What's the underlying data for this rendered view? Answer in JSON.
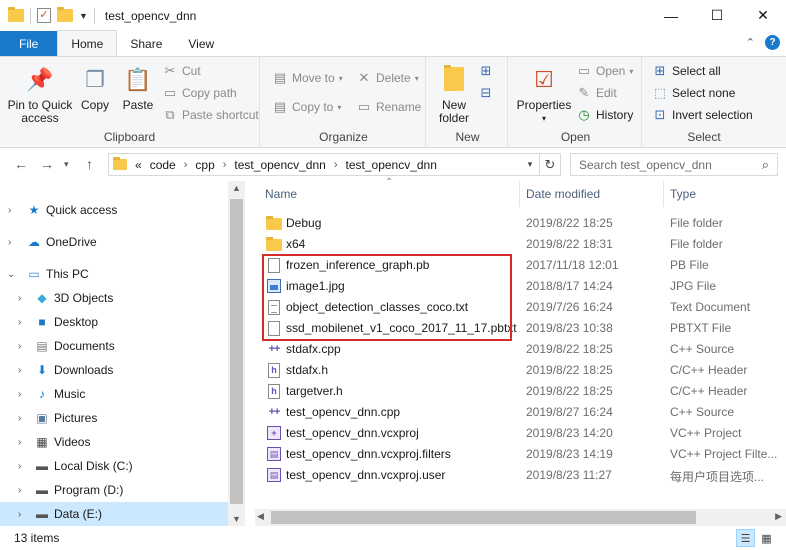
{
  "window": {
    "title": "test_opencv_dnn",
    "controls": {
      "minimize": "—",
      "maximize": "☐",
      "close": "✕"
    }
  },
  "ribbon_tabs": [
    {
      "label": "File"
    },
    {
      "label": "Home"
    },
    {
      "label": "Share"
    },
    {
      "label": "View"
    }
  ],
  "ribbon": {
    "clipboard": {
      "label": "Clipboard",
      "pin": "Pin to Quick access",
      "copy": "Copy",
      "paste": "Paste",
      "cut": "Cut",
      "copy_path": "Copy path",
      "paste_shortcut": "Paste shortcut"
    },
    "organize": {
      "label": "Organize",
      "move_to": "Move to",
      "copy_to": "Copy to",
      "delete": "Delete",
      "rename": "Rename"
    },
    "new": {
      "label": "New",
      "new_folder": "New folder"
    },
    "open": {
      "label": "Open",
      "properties": "Properties",
      "open": "Open",
      "edit": "Edit",
      "history": "History"
    },
    "select": {
      "label": "Select",
      "select_all": "Select all",
      "select_none": "Select none",
      "invert_selection": "Invert selection"
    }
  },
  "address": {
    "overflow": "«",
    "crumbs": [
      "code",
      "cpp",
      "test_opencv_dnn",
      "test_opencv_dnn"
    ],
    "search_placeholder": "Search test_opencv_dnn"
  },
  "nav_pane": {
    "items": [
      {
        "label": "Quick access",
        "icon": "star-icon"
      },
      {
        "label": "OneDrive",
        "icon": "cloud-icon"
      },
      {
        "label": "This PC",
        "icon": "computer-icon"
      },
      {
        "label": "3D Objects",
        "icon": "cube-icon"
      },
      {
        "label": "Desktop",
        "icon": "desktop-icon"
      },
      {
        "label": "Documents",
        "icon": "documents-icon"
      },
      {
        "label": "Downloads",
        "icon": "download-icon"
      },
      {
        "label": "Music",
        "icon": "music-icon"
      },
      {
        "label": "Pictures",
        "icon": "pictures-icon"
      },
      {
        "label": "Videos",
        "icon": "videos-icon"
      },
      {
        "label": "Local Disk (C:)",
        "icon": "drive-icon"
      },
      {
        "label": "Program (D:)",
        "icon": "drive-icon"
      },
      {
        "label": "Data (E:)",
        "icon": "drive-icon",
        "selected": true
      }
    ]
  },
  "file_list": {
    "columns": {
      "name": "Name",
      "date": "Date modified",
      "type": "Type"
    },
    "files": [
      {
        "name": "Debug",
        "date": "2019/8/22 18:25",
        "type": "File folder",
        "icon": "folder"
      },
      {
        "name": "x64",
        "date": "2019/8/22 18:31",
        "type": "File folder",
        "icon": "folder"
      },
      {
        "name": "frozen_inference_graph.pb",
        "date": "2017/11/18 12:01",
        "type": "PB File",
        "icon": "file"
      },
      {
        "name": "image1.jpg",
        "date": "2018/8/17 14:24",
        "type": "JPG File",
        "icon": "image"
      },
      {
        "name": "object_detection_classes_coco.txt",
        "date": "2019/7/26 16:24",
        "type": "Text Document",
        "icon": "text"
      },
      {
        "name": "ssd_mobilenet_v1_coco_2017_11_17.pbtxt",
        "date": "2019/8/23 10:38",
        "type": "PBTXT File",
        "icon": "file"
      },
      {
        "name": "stdafx.cpp",
        "date": "2019/8/22 18:25",
        "type": "C++ Source",
        "icon": "cpp"
      },
      {
        "name": "stdafx.h",
        "date": "2019/8/22 18:25",
        "type": "C/C++ Header",
        "icon": "header"
      },
      {
        "name": "targetver.h",
        "date": "2019/8/22 18:25",
        "type": "C/C++ Header",
        "icon": "header"
      },
      {
        "name": "test_opencv_dnn.cpp",
        "date": "2019/8/27 16:24",
        "type": "C++ Source",
        "icon": "cpp"
      },
      {
        "name": "test_opencv_dnn.vcxproj",
        "date": "2019/8/23 14:20",
        "type": "VC++ Project",
        "icon": "project"
      },
      {
        "name": "test_opencv_dnn.vcxproj.filters",
        "date": "2019/8/23 14:19",
        "type": "VC++ Project Filte...",
        "icon": "project"
      },
      {
        "name": "test_opencv_dnn.vcxproj.user",
        "date": "2019/8/23 11:27",
        "type": "每用户项目选项...",
        "icon": "project"
      }
    ]
  },
  "status": {
    "item_count": "13 items"
  },
  "colors": {
    "accent": "#1979ca",
    "selection": "#cce8ff",
    "highlight_box": "#d42a2a"
  }
}
